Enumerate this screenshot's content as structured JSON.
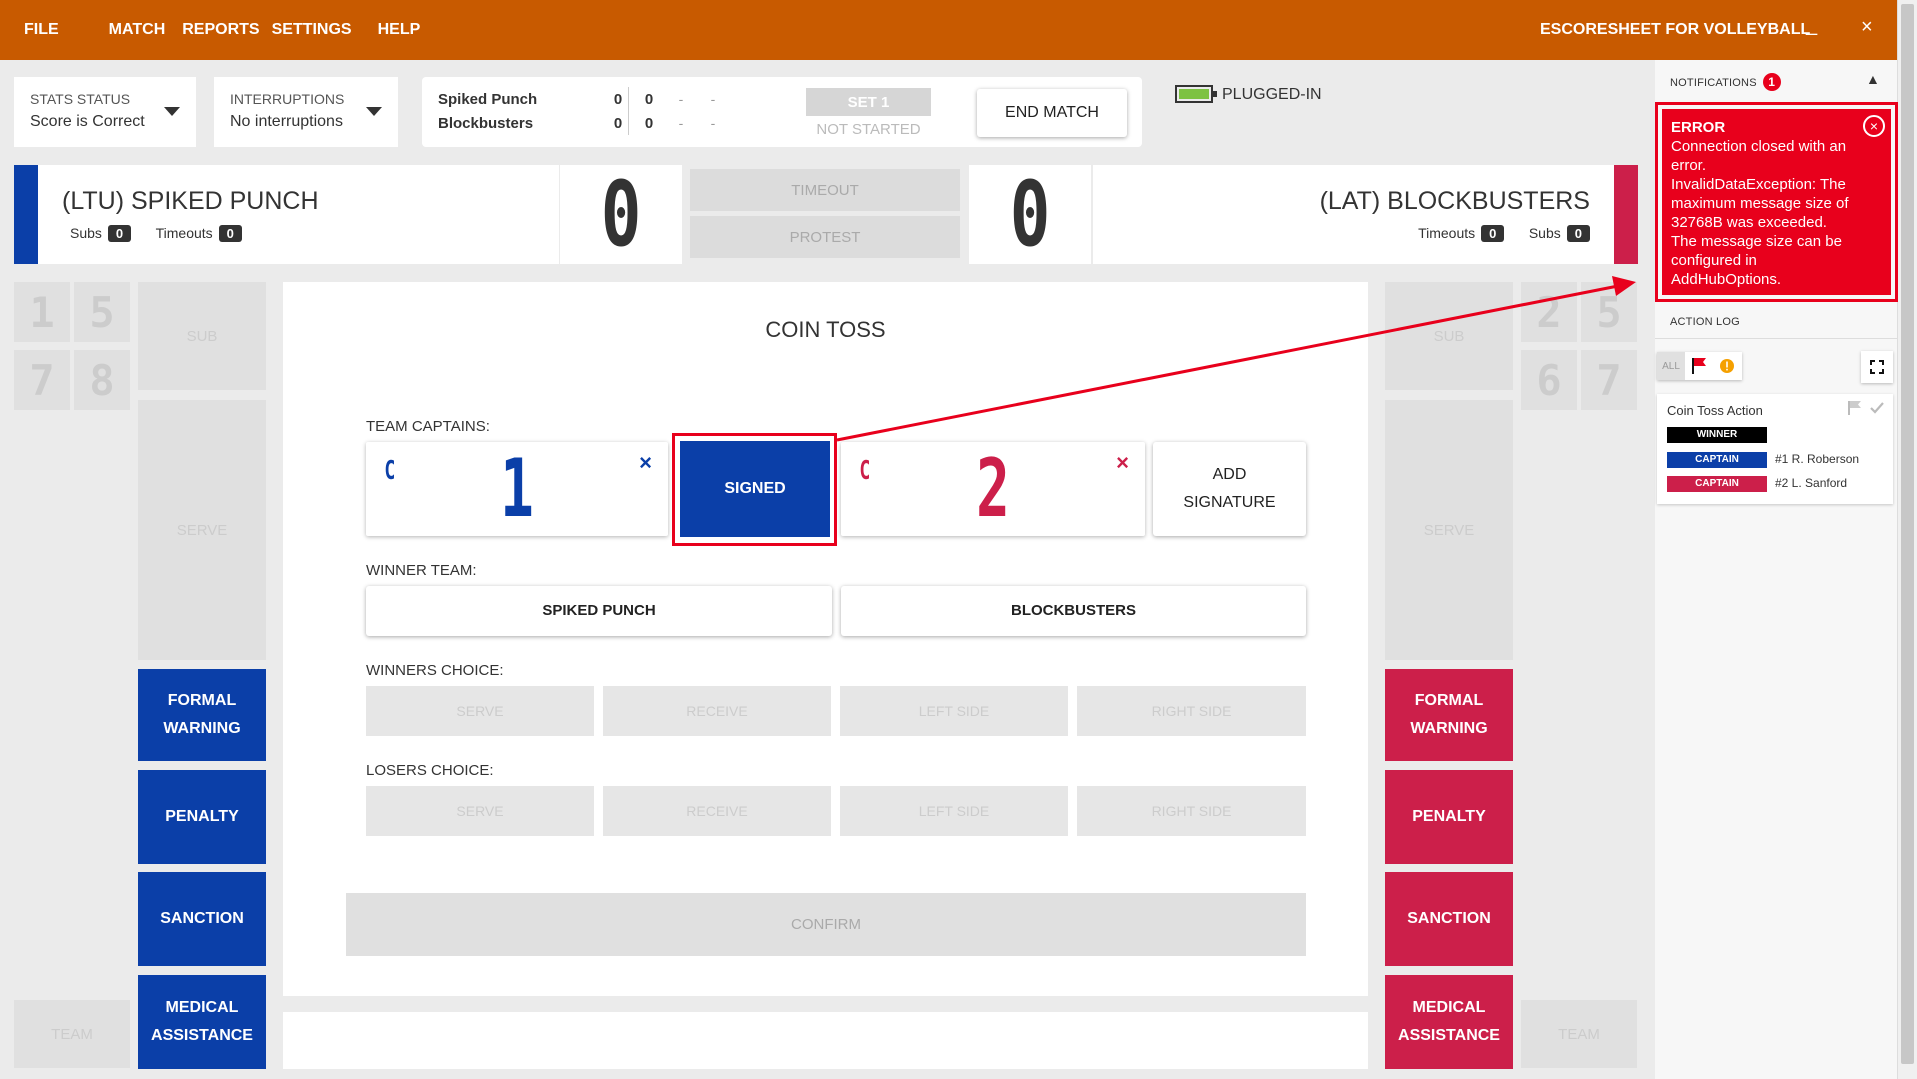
{
  "menu": {
    "file": "FILE",
    "match": "MATCH",
    "reports": "REPORTS",
    "settings": "SETTINGS",
    "help": "HELP",
    "app_title": "ESCORESHEET FOR VOLLEYBALL",
    "minimize": "_",
    "close": "×"
  },
  "status": {
    "stats_label": "STATS STATUS",
    "stats_value": "Score is Correct",
    "interruptions_label": "INTERRUPTIONS",
    "interruptions_value": "No interruptions",
    "team_a": "Spiked Punch",
    "team_b": "Blockbusters",
    "team_a_scores": [
      "0",
      "0",
      "-",
      "-"
    ],
    "team_b_scores": [
      "0",
      "0",
      "-",
      "-"
    ],
    "set_label": "SET 1",
    "set_status": "NOT STARTED",
    "end_match": "END MATCH",
    "power": "PLUGGED-IN"
  },
  "home": {
    "name": "(LTU) SPIKED PUNCH",
    "subs_label": "Subs",
    "subs": "0",
    "timeouts_label": "Timeouts",
    "timeouts": "0",
    "score": "0",
    "color": "#0b3fa8",
    "positions": [
      "1",
      "5",
      "7",
      "8"
    ]
  },
  "away": {
    "name": "(LAT) BLOCKBUSTERS",
    "subs_label": "Subs",
    "subs": "0",
    "timeouts_label": "Timeouts",
    "timeouts": "0",
    "score": "0",
    "color": "#cc1f4a",
    "positions": [
      "2",
      "5",
      "6",
      "7"
    ]
  },
  "center_buttons": {
    "timeout": "TIMEOUT",
    "protest": "PROTEST"
  },
  "side": {
    "sub": "SUB",
    "serve": "SERVE",
    "team": "TEAM",
    "formal_warning_1": "FORMAL",
    "formal_warning_2": "WARNING",
    "penalty": "PENALTY",
    "sanction": "SANCTION",
    "medical_1": "MEDICAL",
    "medical_2": "ASSISTANCE"
  },
  "coin_toss": {
    "title": "COIN TOSS",
    "captains_label": "TEAM CAPTAINS:",
    "captain_mark": "C",
    "home_captain": "1",
    "away_captain": "2",
    "remove": "×",
    "signed": "SIGNED",
    "add_signature_1": "ADD",
    "add_signature_2": "SIGNATURE",
    "winner_label": "WINNER TEAM:",
    "winner_home": "SPIKED PUNCH",
    "winner_away": "BLOCKBUSTERS",
    "winners_choice_label": "WINNERS CHOICE:",
    "losers_choice_label": "LOSERS CHOICE:",
    "choices": [
      "SERVE",
      "RECEIVE",
      "LEFT SIDE",
      "RIGHT SIDE"
    ],
    "confirm": "CONFIRM"
  },
  "notifications": {
    "label": "NOTIFICATIONS",
    "count": "1",
    "collapse": "▲",
    "error_title": "ERROR",
    "error_lines": [
      "Connection closed with an",
      "error.",
      "InvalidDataException: The",
      "maximum message size of",
      "32768B was exceeded.",
      "The message size can be",
      "configured in",
      "AddHubOptions."
    ],
    "close": "×"
  },
  "action_log": {
    "label": "ACTION LOG",
    "filter_all": "ALL",
    "entry_title": "Coin Toss Action",
    "winner_tag": "WINNER",
    "captain_tag": "CAPTAIN",
    "home_captain": "#1 R. Roberson",
    "away_captain": "#2 L. Sanford"
  }
}
